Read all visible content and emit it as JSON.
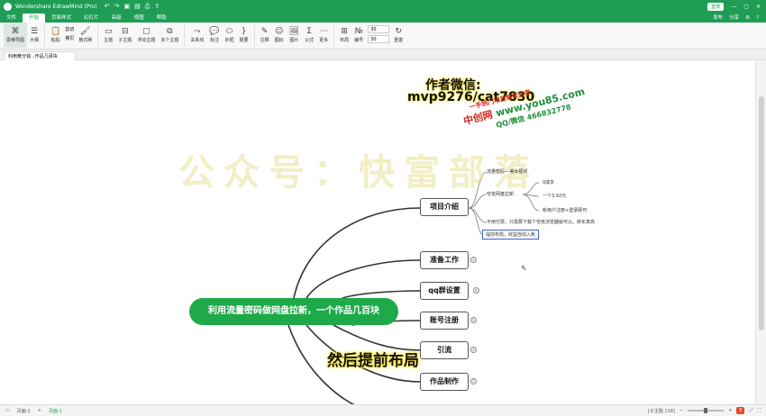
{
  "titlebar": {
    "app_title": "Wondershare EdrawMind (Pro)",
    "login_label": "登录",
    "qa_icons": [
      "undo-icon",
      "redo-icon",
      "save-icon",
      "open-icon",
      "print-icon",
      "export-icon"
    ]
  },
  "menubar": {
    "tabs": [
      "文件",
      "开始",
      "页面样式",
      "幻灯片",
      "高级",
      "视图",
      "帮助"
    ],
    "active": "开始",
    "publish": "发布",
    "share": "分享"
  },
  "ribbon": {
    "mindmap": "思维导图",
    "outline": "大纲",
    "paste": "粘贴",
    "cut": "剪切",
    "copy": "拷贝",
    "format_painter": "格式刷",
    "topic": "主题",
    "subtopic": "子主题",
    "floating_topic": "浮动主题",
    "multi_topic": "多个主题",
    "relation": "关系线",
    "callout": "标注",
    "boundary": "外框",
    "summary": "概要",
    "note": "注释",
    "mark": "图标",
    "image": "图片",
    "formula": "公式",
    "more": "更多",
    "layout": "布局",
    "numbering": "编号",
    "spacing_h": "30",
    "spacing_v": "30",
    "reset": "重置"
  },
  "doc_tab": "利用黄分钱...作品几百块",
  "watermark": "公众号：快富部落",
  "author_line1": "作者微信:",
  "author_line2": "mvp9276/cat7830",
  "promo": {
    "line1": "一手热门项目每天分享",
    "line2_a": "中创网",
    "line2_b": "www.you85.com",
    "line3": "QQ/微信 466832778"
  },
  "mindmap": {
    "root": "利用流量密码做网盘拉新，一个作品几百块",
    "branches": [
      "项目介绍",
      "准备工作",
      "qq群设置",
      "账号注册",
      "引流",
      "作品制作"
    ],
    "badges": [
      "4",
      "4",
      "6",
      "4",
      "5"
    ],
    "project_subs": [
      "流量密码---美女视频",
      "夸克网盘拉新",
      "0成本",
      "一个3.92元",
      "新用户注册+登录即可",
      "不用付费，只需要下载个夸克浏览器就可以。转化率高",
      "提前布局，收益自动入账"
    ]
  },
  "caption": "然后提前布局",
  "statusbar": {
    "page_label": "页面-1",
    "page_tab": "页面-1",
    "subtopic_count": "[子主题 118]",
    "zoom_badge": "5"
  }
}
